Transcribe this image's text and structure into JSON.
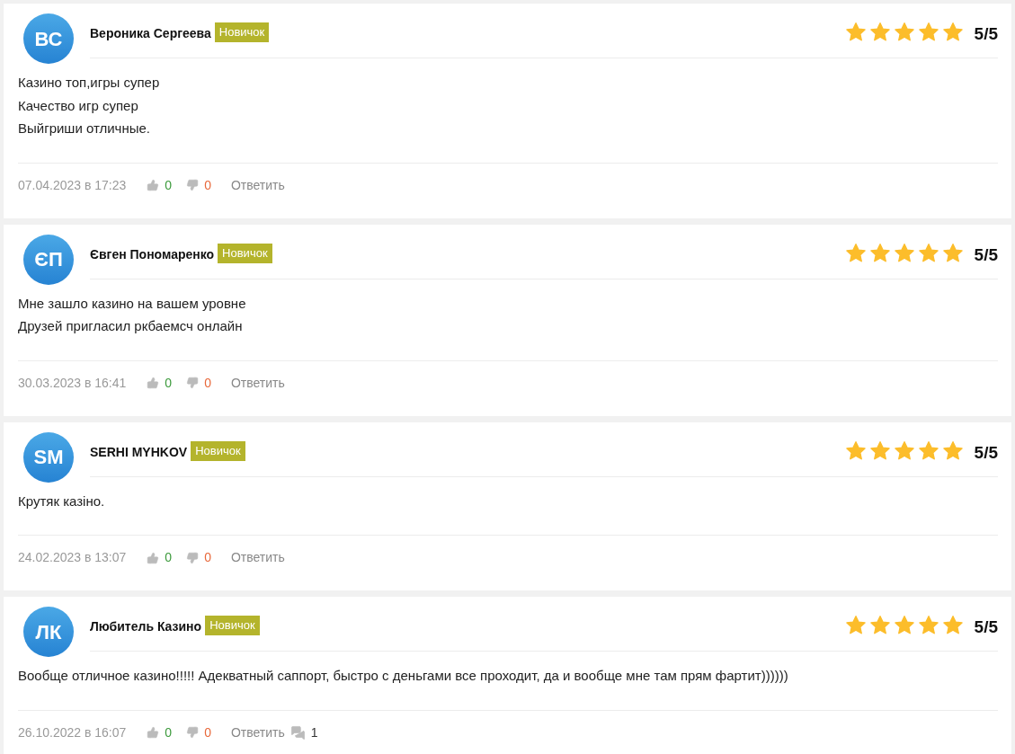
{
  "reviews": [
    {
      "initials": "ВС",
      "author": "Вероника Сергеева",
      "badge": "Новичок",
      "stars": 5,
      "rating": "5/5",
      "lines": [
        "Казино топ,игры супер",
        "Качество игр супер",
        "Выйгриши отличные."
      ],
      "date": "07.04.2023 в 17:23",
      "likes": "0",
      "dislikes": "0",
      "reply": "Ответить"
    },
    {
      "initials": "ЄП",
      "author": "Євген Пономаренко",
      "badge": "Новичок",
      "stars": 5,
      "rating": "5/5",
      "lines": [
        "Мне зашло казино на вашем уровне",
        "Друзей пригласил ркбаемсч онлайн"
      ],
      "date": "30.03.2023 в 16:41",
      "likes": "0",
      "dislikes": "0",
      "reply": "Ответить"
    },
    {
      "initials": "SM",
      "author": "SERHI MYHKOV",
      "badge": "Новичок",
      "stars": 5,
      "rating": "5/5",
      "lines": [
        "Крутяк казіно."
      ],
      "date": "24.02.2023 в 13:07",
      "likes": "0",
      "dislikes": "0",
      "reply": "Ответить"
    },
    {
      "initials": "ЛК",
      "author": "Любитель Казино",
      "badge": "Новичок",
      "stars": 5,
      "rating": "5/5",
      "lines": [
        "Вообще отличное казино!!!!! Адекватный саппорт, быстро с деньгами все проходит, да и вообще мне там прям фартит))))))"
      ],
      "date": "26.10.2022 в 16:07",
      "likes": "0",
      "dislikes": "0",
      "reply": "Ответить",
      "comments": "1"
    }
  ]
}
